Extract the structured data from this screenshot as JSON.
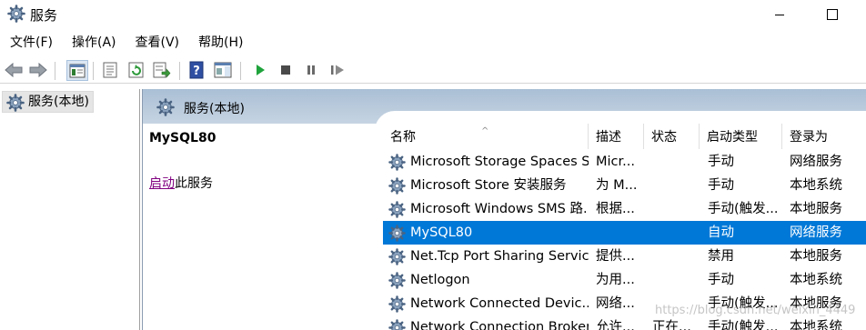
{
  "window": {
    "title": "服务",
    "icon": "gear-icon"
  },
  "menu": [
    "文件(F)",
    "操作(A)",
    "查看(V)",
    "帮助(H)"
  ],
  "toolbar": {
    "icons": [
      "back-arrow-icon",
      "forward-arrow-icon",
      "console-tree-icon",
      "properties-icon",
      "refresh-icon",
      "export-list-icon",
      "help-icon",
      "show-hide-action-pane-icon",
      "start-service-icon",
      "stop-service-icon",
      "pause-service-icon",
      "restart-service-icon"
    ]
  },
  "tree": {
    "item": "服务(本地)"
  },
  "pane": {
    "header": "服务(本地)"
  },
  "detail": {
    "service_name": "MySQL80",
    "action_link": "启动",
    "action_suffix": "此服务"
  },
  "list": {
    "columns": [
      "名称",
      "描述",
      "状态",
      "启动类型",
      "登录为"
    ],
    "rows": [
      {
        "name": "Microsoft Storage Spaces S...",
        "desc": "Micr...",
        "state": "",
        "start": "手动",
        "logon": "网络服务"
      },
      {
        "name": "Microsoft Store 安装服务",
        "desc": "为 M...",
        "state": "",
        "start": "手动",
        "logon": "本地系统"
      },
      {
        "name": "Microsoft Windows SMS 路...",
        "desc": "根据...",
        "state": "",
        "start": "手动(触发...",
        "logon": "本地服务"
      },
      {
        "name": "MySQL80",
        "desc": "",
        "state": "",
        "start": "自动",
        "logon": "网络服务",
        "selected": true
      },
      {
        "name": "Net.Tcp Port Sharing Service",
        "desc": "提供...",
        "state": "",
        "start": "禁用",
        "logon": "本地服务"
      },
      {
        "name": "Netlogon",
        "desc": "为用...",
        "state": "",
        "start": "手动",
        "logon": "本地系统"
      },
      {
        "name": "Network Connected Devic...",
        "desc": "网络...",
        "state": "",
        "start": "手动(触发...",
        "logon": "本地服务"
      },
      {
        "name": "Network Connection Broker",
        "desc": "允许...",
        "state": "正在...",
        "start": "手动(触发...",
        "logon": "本地系统"
      }
    ]
  },
  "watermark": "https://blog.csdn.net/weixin_4449"
}
